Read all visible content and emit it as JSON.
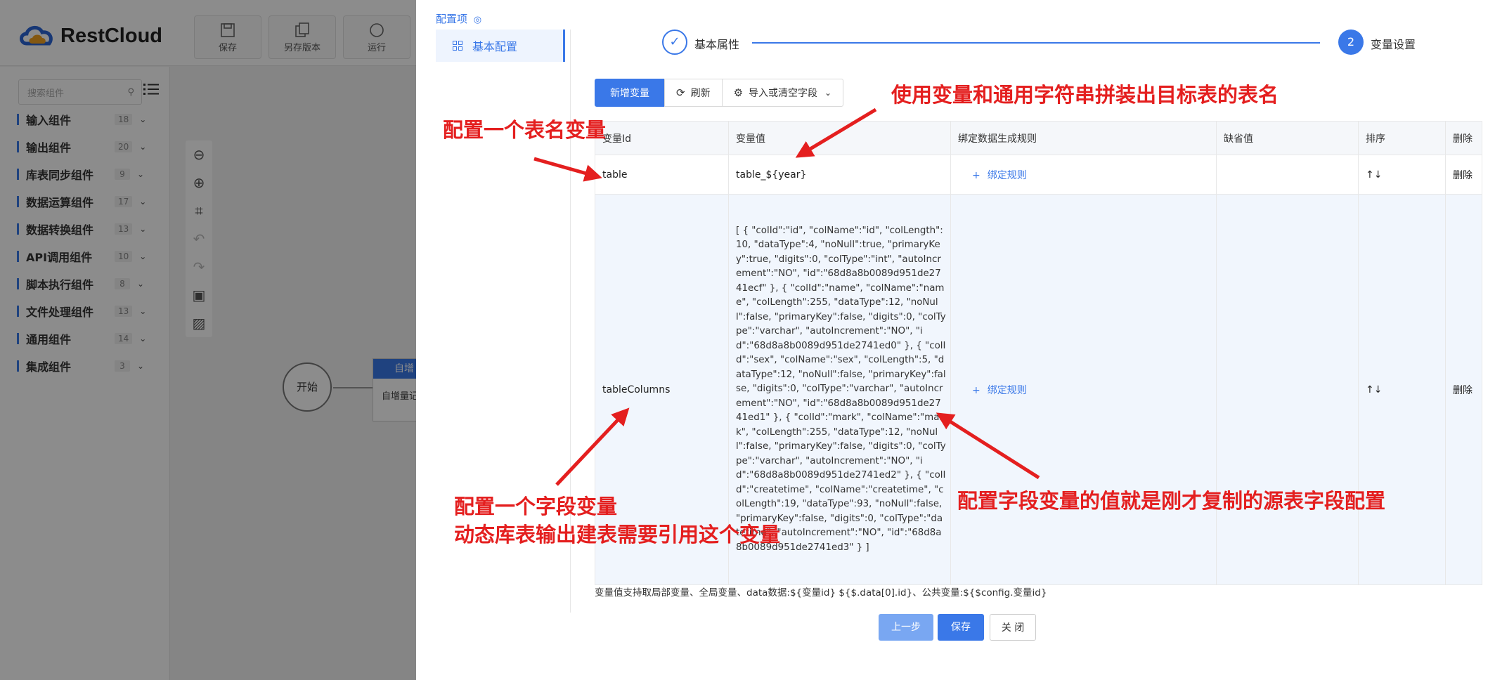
{
  "app": {
    "brand": "RestCloud",
    "toolbar": [
      {
        "label": "保存",
        "icon": "save-icon"
      },
      {
        "label": "另存版本",
        "icon": "copy-icon"
      },
      {
        "label": "运行",
        "icon": "run-icon"
      }
    ],
    "search_placeholder": "搜索组件",
    "categories": [
      {
        "name": "输入组件",
        "count": "18"
      },
      {
        "name": "输出组件",
        "count": "20"
      },
      {
        "name": "库表同步组件",
        "count": "9"
      },
      {
        "name": "数据运算组件",
        "count": "17"
      },
      {
        "name": "数据转换组件",
        "count": "13"
      },
      {
        "name": "API调用组件",
        "count": "10"
      },
      {
        "name": "脚本执行组件",
        "count": "8"
      },
      {
        "name": "文件处理组件",
        "count": "13"
      },
      {
        "name": "通用组件",
        "count": "14"
      },
      {
        "name": "集成组件",
        "count": "3"
      }
    ],
    "canvas": {
      "start_node": "开始",
      "node_header": "自增量",
      "node_sub": "自增量记"
    }
  },
  "drawer": {
    "config_title": "配置项",
    "config_item": "基本配置",
    "steps": [
      {
        "label": "基本属性",
        "marker": "✓"
      },
      {
        "label": "变量设置",
        "marker": "2"
      }
    ],
    "toolbar": {
      "add": "新增变量",
      "refresh": "刷新",
      "import": "导入或清空字段"
    },
    "table": {
      "headers": [
        "变量Id",
        "变量值",
        "绑定数据生成规则",
        "缺省值",
        "排序",
        "删除"
      ],
      "rows": [
        {
          "id": "table",
          "value": "table_${year}",
          "rule": "绑定规则",
          "default": "",
          "sort": "↑↓",
          "delete": "删除"
        },
        {
          "id": "tableColumns",
          "value": "[ { \"colId\":\"id\", \"colName\":\"id\", \"colLength\":10, \"dataType\":4, \"noNull\":true, \"primaryKey\":true, \"digits\":0, \"colType\":\"int\", \"autoIncrement\":\"NO\", \"id\":\"68d8a8b0089d951de2741ecf\" }, { \"colId\":\"name\", \"colName\":\"name\", \"colLength\":255, \"dataType\":12, \"noNull\":false, \"primaryKey\":false, \"digits\":0, \"colType\":\"varchar\", \"autoIncrement\":\"NO\", \"id\":\"68d8a8b0089d951de2741ed0\" }, { \"colId\":\"sex\", \"colName\":\"sex\", \"colLength\":5, \"dataType\":12, \"noNull\":false, \"primaryKey\":false, \"digits\":0, \"colType\":\"varchar\", \"autoIncrement\":\"NO\", \"id\":\"68d8a8b0089d951de2741ed1\" }, { \"colId\":\"mark\", \"colName\":\"mark\", \"colLength\":255, \"dataType\":12, \"noNull\":false, \"primaryKey\":false, \"digits\":0, \"colType\":\"varchar\", \"autoIncrement\":\"NO\", \"id\":\"68d8a8b0089d951de2741ed2\" }, { \"colId\":\"createtime\", \"colName\":\"createtime\", \"colLength\":19, \"dataType\":93, \"noNull\":false, \"primaryKey\":false, \"digits\":0, \"colType\":\"datetime\", \"autoIncrement\":\"NO\", \"id\":\"68d8a8b0089d951de2741ed3\" } ]",
          "rule": "绑定规则",
          "default": "",
          "sort": "↑↓",
          "delete": "删除"
        }
      ]
    },
    "hint": "变量值支持取局部变量、全局变量、data数据:${变量id} ${$.data[0].id}、公共变量:${$config.变量id}",
    "footer": {
      "prev": "上一步",
      "save": "保存",
      "close": "关 闭"
    }
  },
  "annotations": {
    "a1": "使用变量和通用字符串拼装出目标表的表名",
    "a2": "配置一个表名变量",
    "a3_line1": "配置一个字段变量",
    "a3_line2": "动态库表输出建表需要引用这个变量",
    "a4": "配置字段变量的值就是刚才复制的源表字段配置"
  },
  "colors": {
    "accent": "#3a78e8",
    "annotation": "#e41f1f"
  }
}
